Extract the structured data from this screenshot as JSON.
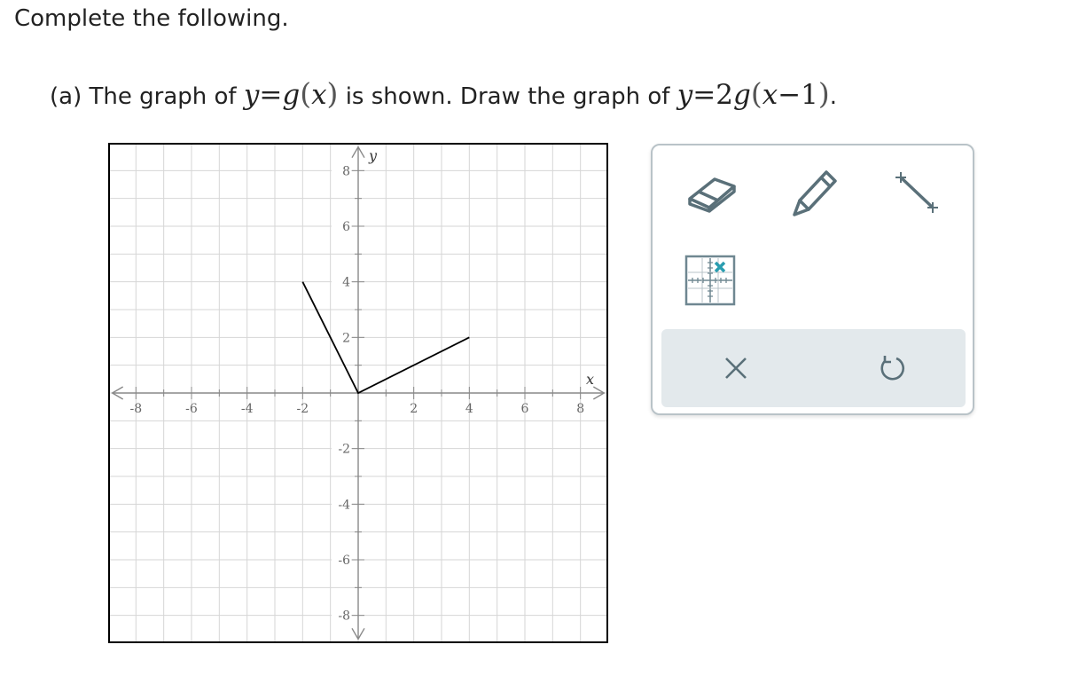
{
  "instruction": "Complete the following.",
  "question": {
    "part_label": "(a)",
    "text_1": "The graph of",
    "expr_1": {
      "lhs": "y",
      "eq": "=",
      "func": "g",
      "lp": "(",
      "arg": "x",
      "rp": ")"
    },
    "text_2": "is shown. Draw the graph of",
    "expr_2": {
      "lhs": "y",
      "eq": "=",
      "coef": "2",
      "func": "g",
      "lp": "(",
      "arg": "x",
      "minus": "−",
      "num": "1",
      "rp": ")"
    },
    "text_3": "."
  },
  "graph": {
    "x_label": "x",
    "y_label": "y",
    "x_range": [
      -9,
      9
    ],
    "y_range": [
      -9,
      9
    ],
    "x_tick_labels": [
      "-8",
      "-6",
      "-4",
      "-2",
      "2",
      "4",
      "6",
      "8"
    ],
    "y_tick_labels": [
      "8",
      "6",
      "4",
      "2",
      "-2",
      "-4",
      "-6",
      "-8"
    ],
    "given_function_points": [
      [
        -2,
        4
      ],
      [
        0,
        0
      ],
      [
        4,
        2
      ]
    ],
    "colors": {
      "grid": "#d6d6d6",
      "axis": "#888888",
      "curve": "#000000"
    }
  },
  "toolbox": {
    "tools": [
      "eraser-icon",
      "pencil-icon",
      "line-segment-icon",
      "graph-point-icon"
    ],
    "actions": [
      "clear-icon",
      "undo-icon"
    ],
    "colors": {
      "icon": "#5a7079",
      "accent": "#2a9db0",
      "bar": "#e3e9ec"
    }
  }
}
